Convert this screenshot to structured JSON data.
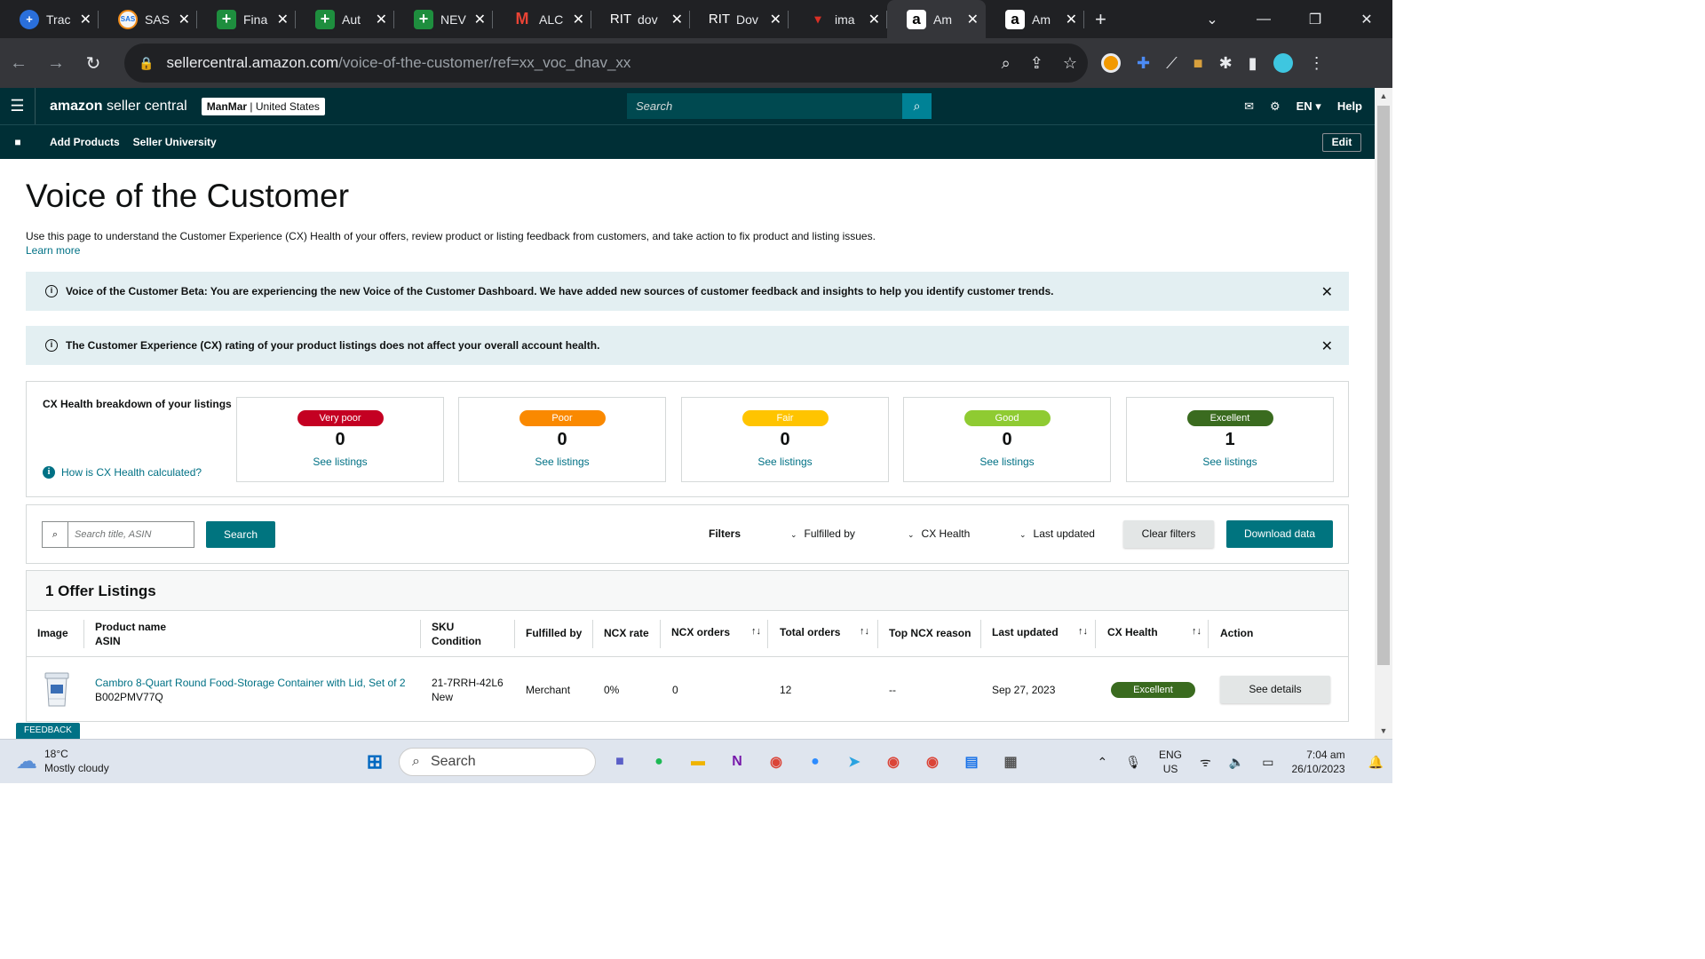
{
  "browser": {
    "tabs": [
      {
        "title": "Trac",
        "icon": "clinic-icon",
        "fav": "+"
      },
      {
        "title": "SAS",
        "icon": "sas-icon",
        "fav": "SAS"
      },
      {
        "title": "Fina",
        "icon": "sheets-icon",
        "fav": "+"
      },
      {
        "title": "Aut",
        "icon": "sheets-icon",
        "fav": "+"
      },
      {
        "title": "NEV",
        "icon": "sheets-icon",
        "fav": "+"
      },
      {
        "title": "ALC",
        "icon": "gmail-icon",
        "fav": "M"
      },
      {
        "title": "dov",
        "icon": "rit-icon",
        "fav": "RIT"
      },
      {
        "title": "Dov",
        "icon": "rit-icon",
        "fav": "RIT"
      },
      {
        "title": "ima",
        "icon": "image-site-icon",
        "fav": "▾"
      },
      {
        "title": "Am",
        "icon": "amazon-icon",
        "fav": "a",
        "active": true
      },
      {
        "title": "Am",
        "icon": "amazon-icon",
        "fav": "a"
      }
    ],
    "url_host": "sellercentral.amazon.com",
    "url_path": "/voice-of-the-customer/ref=xx_voc_dnav_xx"
  },
  "header": {
    "logo_brand": "amazon",
    "logo_rest": " seller central",
    "account_name": "ManMar",
    "account_region": " | United States",
    "search_placeholder": "Search",
    "lang": "EN",
    "help": "Help"
  },
  "subnav": {
    "links": [
      "Add Products",
      "Seller University"
    ],
    "edit": "Edit"
  },
  "page": {
    "title": "Voice of the Customer",
    "description": "Use this page to understand the Customer Experience (CX) Health of your offers, review product or listing feedback from customers, and take action to fix product and listing issues.",
    "learn_more": "Learn more"
  },
  "alerts": [
    "Voice of the Customer Beta: You are experiencing the new Voice of the Customer Dashboard. We have added new sources of customer feedback and insights to help you identify customer trends.",
    "The Customer Experience (CX) rating of your product listings does not affect your overall account health."
  ],
  "cx_health": {
    "title": "CX Health breakdown of your listings",
    "how_link": "How is CX Health calculated?",
    "cards": [
      {
        "label": "Very poor",
        "count": "0",
        "link": "See listings",
        "color": "#c40022"
      },
      {
        "label": "Poor",
        "count": "0",
        "link": "See listings",
        "color": "#fa8900"
      },
      {
        "label": "Fair",
        "count": "0",
        "link": "See listings",
        "color": "#ffc400"
      },
      {
        "label": "Good",
        "count": "0",
        "link": "See listings",
        "color": "#8fcb32"
      },
      {
        "label": "Excellent",
        "count": "1",
        "link": "See listings",
        "color": "#3a6b1f"
      }
    ]
  },
  "filters": {
    "search_placeholder": "Search title, ASIN",
    "search_button": "Search",
    "label": "Filters",
    "dropdowns": [
      "Fulfilled by",
      "CX Health",
      "Last updated"
    ],
    "clear": "Clear filters",
    "download": "Download data"
  },
  "listings": {
    "heading": "1 Offer Listings",
    "columns": {
      "image": "Image",
      "product_name": "Product name",
      "asin": "ASIN",
      "sku": "SKU",
      "condition": "Condition",
      "fulfilled_by": "Fulfilled by",
      "ncx_rate": "NCX rate",
      "ncx_orders": "NCX orders",
      "total_orders": "Total orders",
      "top_ncx_reason": "Top NCX reason",
      "last_updated": "Last updated",
      "cx_health": "CX Health",
      "action": "Action"
    },
    "rows": [
      {
        "product_name": "Cambro 8-Quart Round Food-Storage Container with Lid, Set of 2",
        "asin": "B002PMV77Q",
        "sku": "21-7RRH-42L6",
        "condition": "New",
        "fulfilled_by": "Merchant",
        "ncx_rate": "0%",
        "ncx_orders": "0",
        "total_orders": "12",
        "top_ncx_reason": "--",
        "last_updated": "Sep 27, 2023",
        "cx_health": "Excellent",
        "action": "See details"
      }
    ]
  },
  "feedback": "FEEDBACK",
  "taskbar": {
    "temp": "18°C",
    "weather": "Mostly cloudy",
    "search": "Search",
    "lang_top": "ENG",
    "lang_bottom": "US",
    "time": "7:04 am",
    "date": "26/10/2023"
  }
}
